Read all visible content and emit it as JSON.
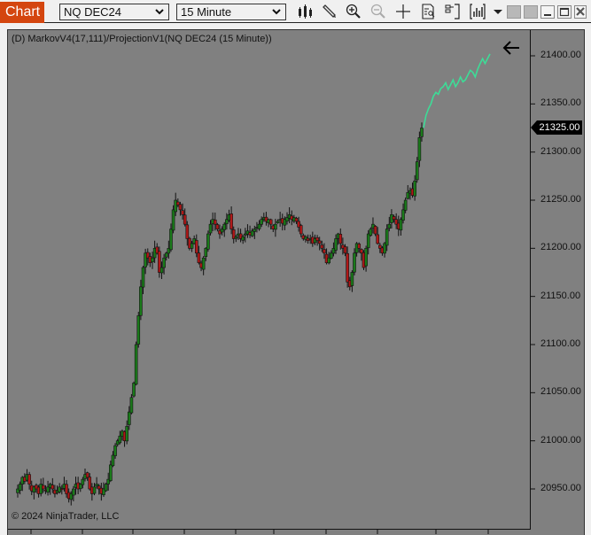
{
  "toolbar": {
    "chart_tab_label": "Chart",
    "instrument": "NQ DEC24",
    "interval": "15 Minute",
    "icons": [
      "bar-type-icon",
      "drawing-tool-pencil-icon",
      "zoom-in-icon",
      "zoom-out-icon",
      "crosshair-icon",
      "data-box-icon",
      "chart-trader-icon",
      "indicators-icon",
      "dropdown-icon"
    ],
    "window_buttons": [
      "tab-color-1",
      "tab-color-2",
      "minimize",
      "maximize",
      "close"
    ]
  },
  "chart": {
    "indicator_label": "(D) MarkovV4(17,111)/ProjectionV1(NQ DEC24 (15 Minute))",
    "copyright": "© 2024 NinjaTrader, LLC",
    "current_price": "21325.00",
    "colors": {
      "background": "#808080",
      "up_candle": "#1a7a1a",
      "down_candle": "#b01818",
      "projection": "#3ddc97",
      "price_marker": "#000000"
    }
  },
  "chart_data": {
    "type": "candlestick",
    "title": "(D) MarkovV4(17,111)/ProjectionV1(NQ DEC24 (15 Minute))",
    "xlabel": "",
    "ylabel": "",
    "y_ticks": [
      "21400.00",
      "21350.00",
      "21300.00",
      "21250.00",
      "21200.00",
      "21150.00",
      "21100.00",
      "21050.00",
      "21000.00",
      "20950.00"
    ],
    "ylim": [
      20915,
      21420
    ],
    "current_price": 21325.0,
    "close_series": [
      20950,
      20955,
      20962,
      20958,
      20965,
      20955,
      20948,
      20952,
      20950,
      20945,
      20955,
      20950,
      20948,
      20952,
      20955,
      20950,
      20945,
      20948,
      20952,
      20950,
      20955,
      20945,
      20940,
      20945,
      20950,
      20955,
      20950,
      20955,
      20960,
      20965,
      20962,
      20950,
      20945,
      20952,
      20955,
      20950,
      20945,
      20950,
      20955,
      20960,
      20975,
      20985,
      20995,
      21000,
      21005,
      21010,
      21000,
      21015,
      21030,
      21045,
      21060,
      21100,
      21130,
      21160,
      21180,
      21195,
      21190,
      21185,
      21190,
      21200,
      21195,
      21175,
      21180,
      21190,
      21195,
      21200,
      21220,
      21240,
      21250,
      21245,
      21240,
      21235,
      21225,
      21210,
      21200,
      21205,
      21210,
      21195,
      21185,
      21180,
      21190,
      21200,
      21215,
      21225,
      21230,
      21225,
      21220,
      21215,
      21220,
      21225,
      21230,
      21235,
      21220,
      21210,
      21212,
      21215,
      21210,
      21212,
      21215,
      21218,
      21214,
      21218,
      21220,
      21222,
      21225,
      21230,
      21232,
      21228,
      21230,
      21225,
      21220,
      21225,
      21228,
      21230,
      21226,
      21230,
      21232,
      21235,
      21230,
      21232,
      21228,
      21222,
      21215,
      21210,
      21212,
      21208,
      21210,
      21205,
      21210,
      21208,
      21205,
      21200,
      21195,
      21185,
      21190,
      21195,
      21200,
      21210,
      21215,
      21205,
      21200,
      21195,
      21165,
      21160,
      21175,
      21195,
      21205,
      21200,
      21195,
      21180,
      21200,
      21215,
      21220,
      21225,
      21215,
      21205,
      21200,
      21195,
      21205,
      21220,
      21225,
      21235,
      21230,
      21225,
      21220,
      21230,
      21240,
      21250,
      21258,
      21260,
      21255,
      21270,
      21290,
      21315,
      21325
    ],
    "projection_series": [
      21325,
      21338,
      21345,
      21350,
      21358,
      21362,
      21360,
      21366,
      21368,
      21372,
      21365,
      21370,
      21375,
      21368,
      21372,
      21378,
      21373,
      21375,
      21380,
      21385,
      21383,
      21378,
      21386,
      21392,
      21397,
      21392,
      21397,
      21402
    ]
  }
}
